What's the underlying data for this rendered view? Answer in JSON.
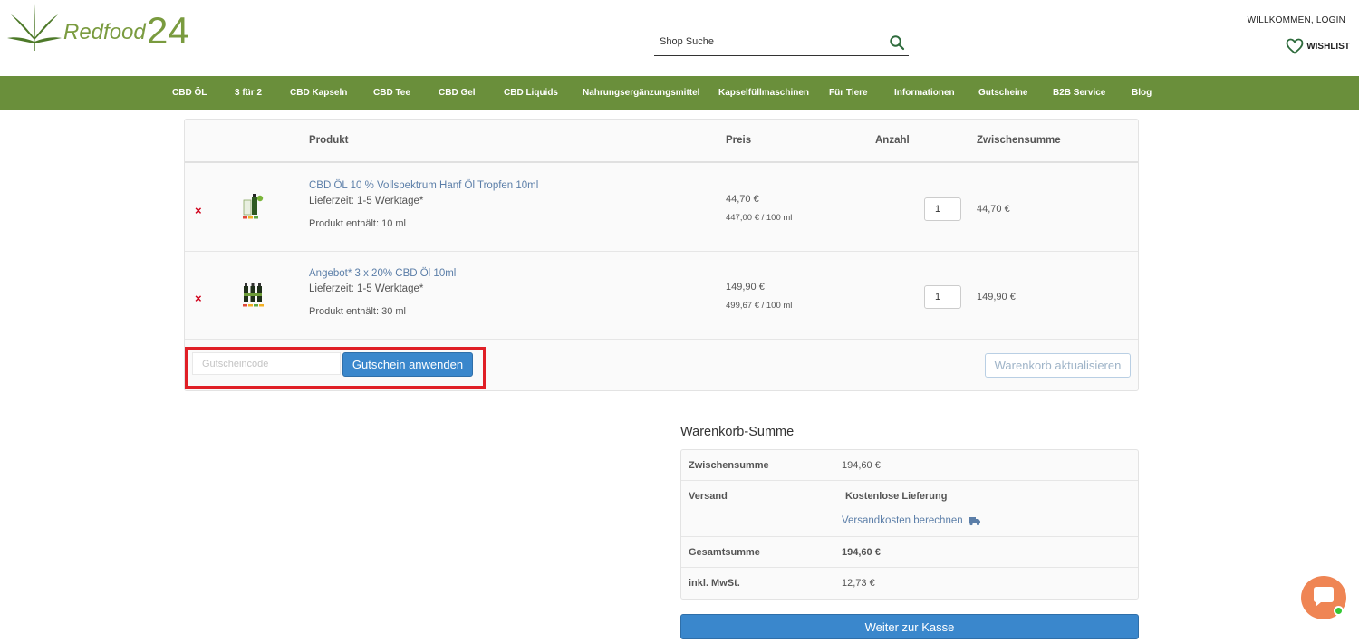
{
  "header": {
    "logo": {
      "word": "Redfood",
      "num": "24"
    },
    "search": {
      "placeholder": "Shop Suche"
    },
    "login_label": "WILLKOMMEN, LOGIN",
    "wishlist_label": "WISHLIST"
  },
  "nav": {
    "items": [
      "CBD ÖL",
      "3 für 2",
      "CBD Kapseln",
      "CBD Tee",
      "CBD Gel",
      "CBD Liquids",
      "Nahrungsergänzungsmittel",
      "Kapselfüllmaschinen",
      "Für Tiere",
      "Informationen",
      "Gutscheine",
      "B2B Service",
      "Blog"
    ],
    "color": "#6a8f3b"
  },
  "cart": {
    "headers": {
      "product": "Produkt",
      "price": "Preis",
      "quantity": "Anzahl",
      "subtotal": "Zwischensumme"
    },
    "remove_icon": "×",
    "items": [
      {
        "name": "CBD ÖL 10 % Vollspektrum Hanf Öl Tropfen 10ml",
        "delivery": "Lieferzeit: 1-5 Werktage*",
        "contents": "Produkt enthält: 10 ml",
        "price": "44,70 €",
        "unit_price": "447,00 € / 100 ml",
        "quantity": "1",
        "subtotal": "44,70 €"
      },
      {
        "name": "Angebot* 3 x 20% CBD Öl 10ml",
        "delivery": "Lieferzeit: 1-5 Werktage*",
        "contents": "Produkt enthält: 30 ml",
        "price": "149,90 €",
        "unit_price": "499,67 € / 100 ml",
        "quantity": "1",
        "subtotal": "149,90 €"
      }
    ],
    "coupon": {
      "placeholder": "Gutscheincode",
      "apply_label": "Gutschein anwenden"
    },
    "update_label": "Warenkorb aktualisieren"
  },
  "totals": {
    "title": "Warenkorb-Summe",
    "subtotal_label": "Zwischensumme",
    "subtotal_value": "194,60 €",
    "shipping_label": "Versand",
    "shipping_value": "Kostenlose Lieferung",
    "shipping_link": "Versandkosten berechnen",
    "total_label": "Gesamtsumme",
    "total_value": "194,60 €",
    "tax_label": "inkl. MwSt.",
    "tax_value": "12,73 €",
    "checkout_label": "Weiter zur Kasse"
  },
  "colors": {
    "accent": "#3a87cc",
    "link": "#5b7ea8",
    "remove": "#d0021b",
    "highlight": "#e01f26",
    "chat": "#ef8554"
  }
}
